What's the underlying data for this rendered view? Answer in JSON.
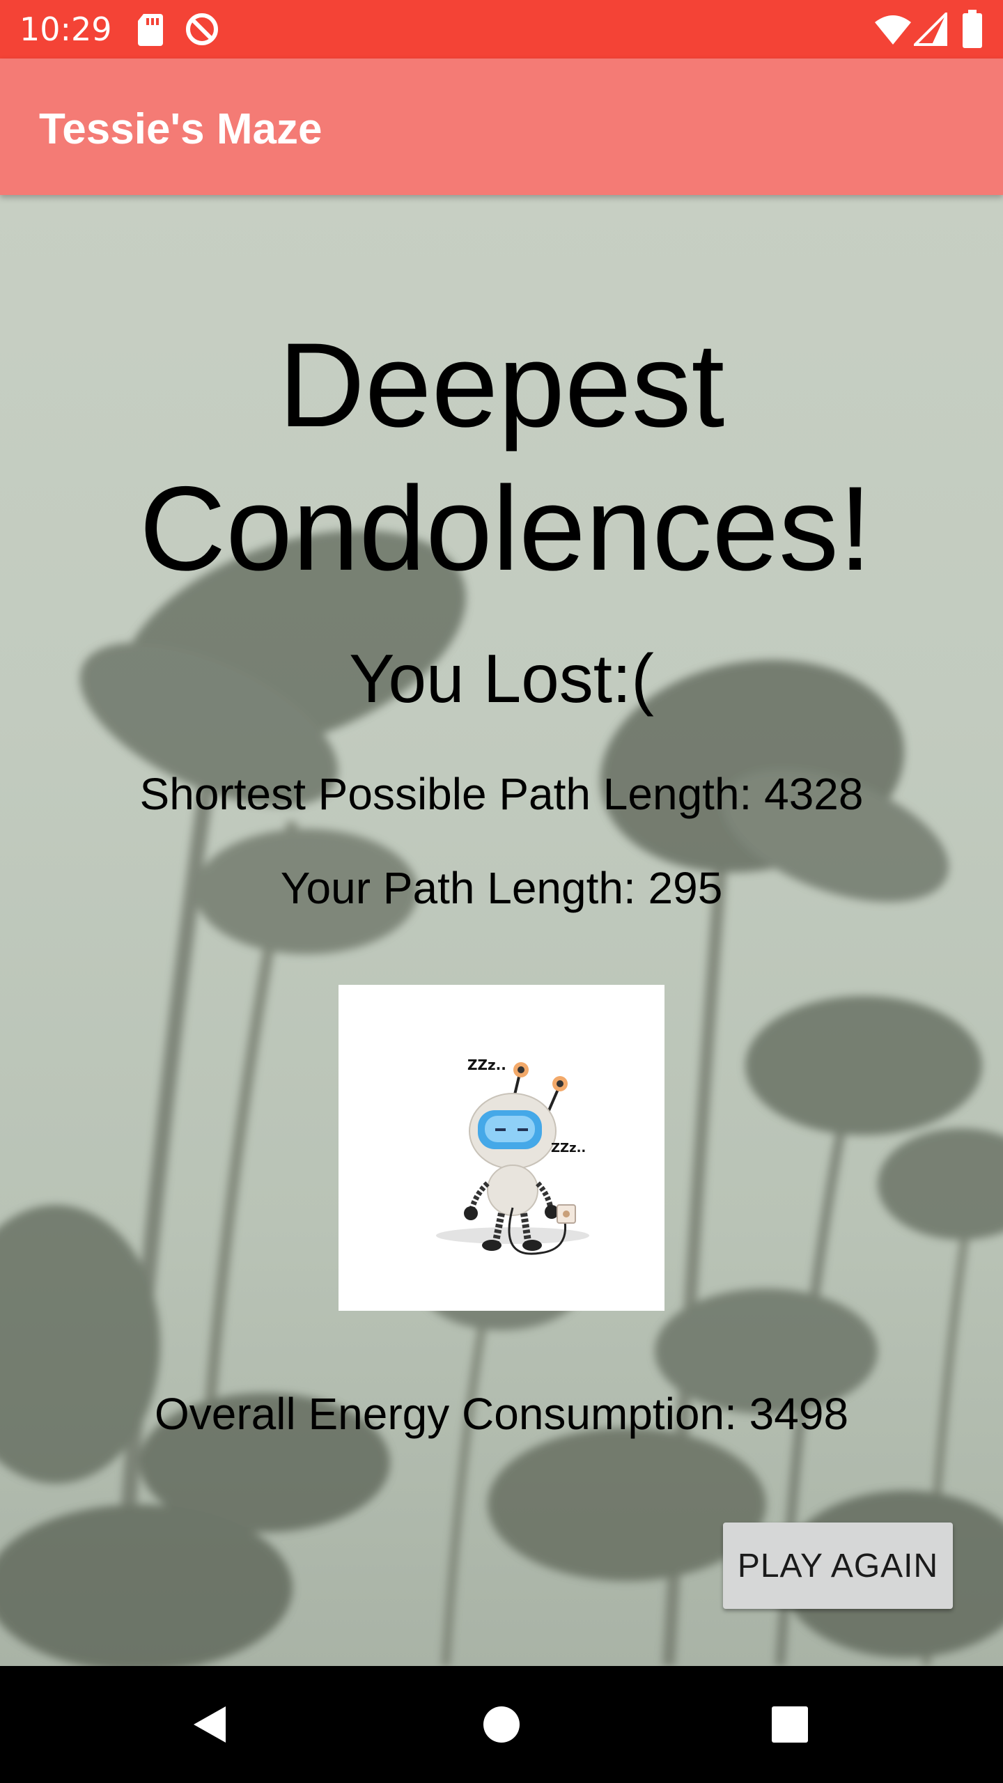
{
  "status_bar": {
    "time": "10:29",
    "icons": [
      "sd-card-icon",
      "sync-icon",
      "wifi-icon",
      "signal-icon",
      "battery-icon"
    ],
    "background": "#f44336"
  },
  "app_bar": {
    "title": "Tessie's Maze",
    "background": "#f47b75"
  },
  "result": {
    "headline": "Deepest Condolences!",
    "subheadline": "You Lost:(",
    "shortest_path": "Shortest Possible Path Length: 4328",
    "your_path": "Your Path Length: 295",
    "energy": "Overall Energy Consumption: 3498",
    "robot_image": "sleeping-robot-icon",
    "robot_snore_1": "ZZz..",
    "robot_snore_2": "ZZz.."
  },
  "actions": {
    "play_again": "PLAY AGAIN"
  },
  "nav_bar": {
    "icons": [
      "back-icon",
      "home-icon",
      "recents-icon"
    ]
  }
}
